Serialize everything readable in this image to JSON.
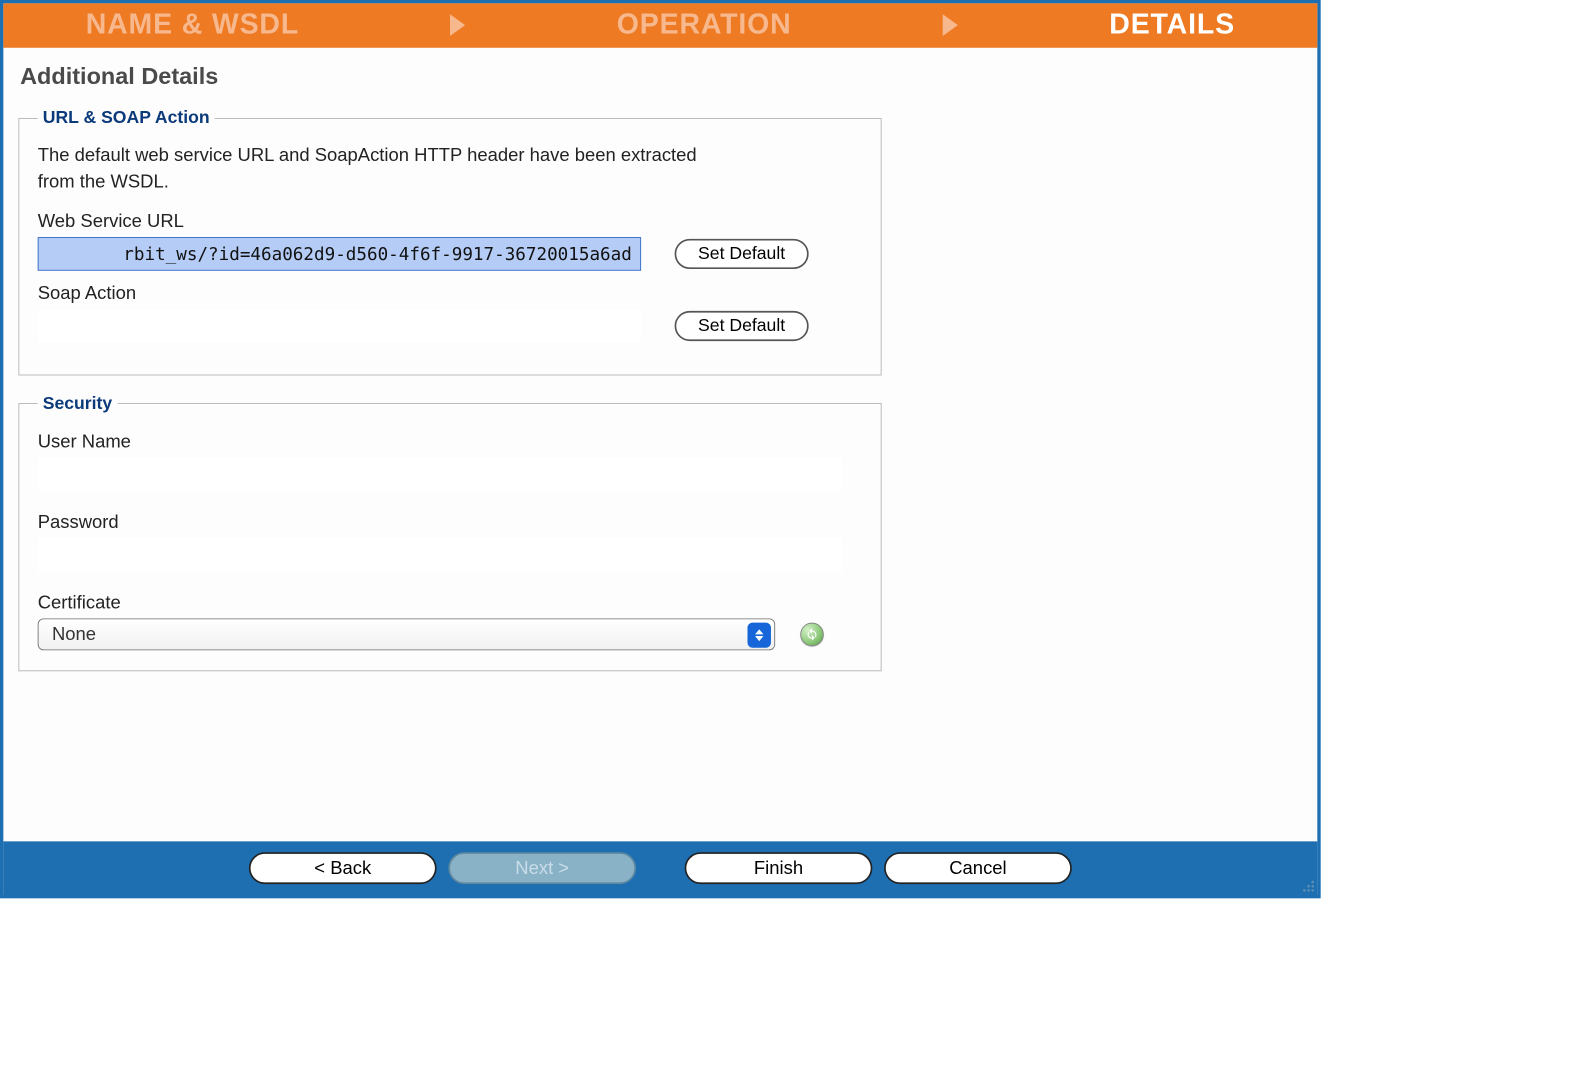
{
  "wizard": {
    "steps": [
      "NAME & WSDL",
      "OPERATION",
      "DETAILS"
    ],
    "active_index": 2
  },
  "page_title": "Additional Details",
  "url_soap": {
    "legend": "URL & SOAP Action",
    "description": "The default web service URL and SoapAction HTTP header have been extracted from the WSDL.",
    "web_service_url_label": "Web Service URL",
    "web_service_url_value": "rbit_ws/?id=46a062d9-d560-4f6f-9917-36720015a6ad",
    "soap_action_label": "Soap Action",
    "soap_action_value": "",
    "set_default_label": "Set Default"
  },
  "security": {
    "legend": "Security",
    "user_name_label": "User Name",
    "user_name_value": "",
    "password_label": "Password",
    "password_value": "",
    "certificate_label": "Certificate",
    "certificate_value": "None"
  },
  "footer": {
    "back": "< Back",
    "next": "Next >",
    "finish": "Finish",
    "cancel": "Cancel",
    "next_disabled": true
  }
}
